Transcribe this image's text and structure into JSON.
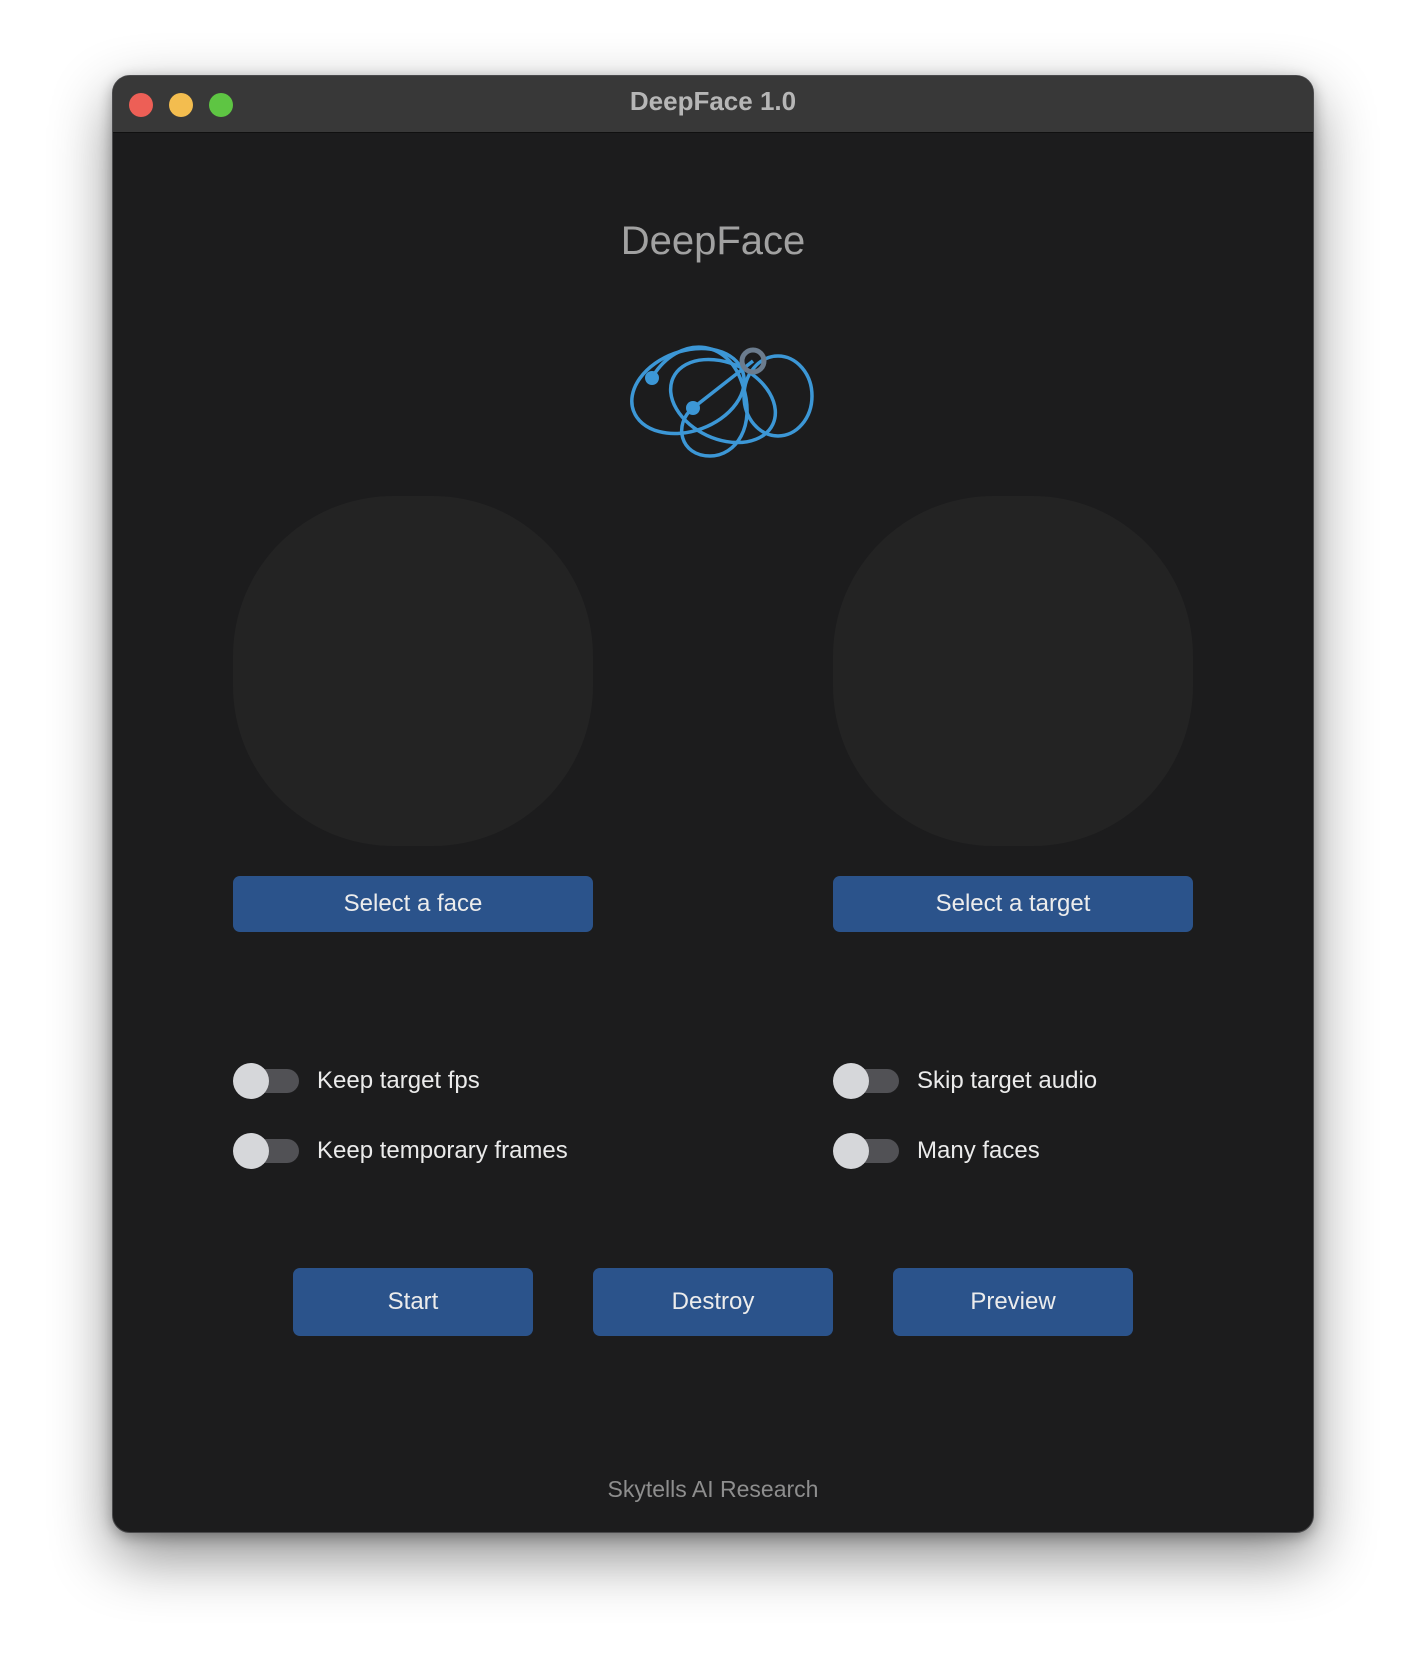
{
  "window": {
    "title": "DeepFace 1.0"
  },
  "header": {
    "title": "DeepFace",
    "logo_icon": "orbit-logo-icon",
    "accent_color": "#3c97d6"
  },
  "face_panel": {
    "select_label": "Select a face"
  },
  "target_panel": {
    "select_label": "Select a target"
  },
  "options": {
    "keep_fps": {
      "label": "Keep target fps",
      "on": false
    },
    "keep_frames": {
      "label": "Keep temporary frames",
      "on": false
    },
    "skip_audio": {
      "label": "Skip target audio",
      "on": false
    },
    "many_faces": {
      "label": "Many faces",
      "on": false
    }
  },
  "actions": {
    "start_label": "Start",
    "destroy_label": "Destroy",
    "preview_label": "Preview"
  },
  "footer": {
    "text": "Skytells AI Research"
  },
  "colors": {
    "button": "#2b538b",
    "background": "#1c1c1d",
    "titlebar": "#383838"
  }
}
